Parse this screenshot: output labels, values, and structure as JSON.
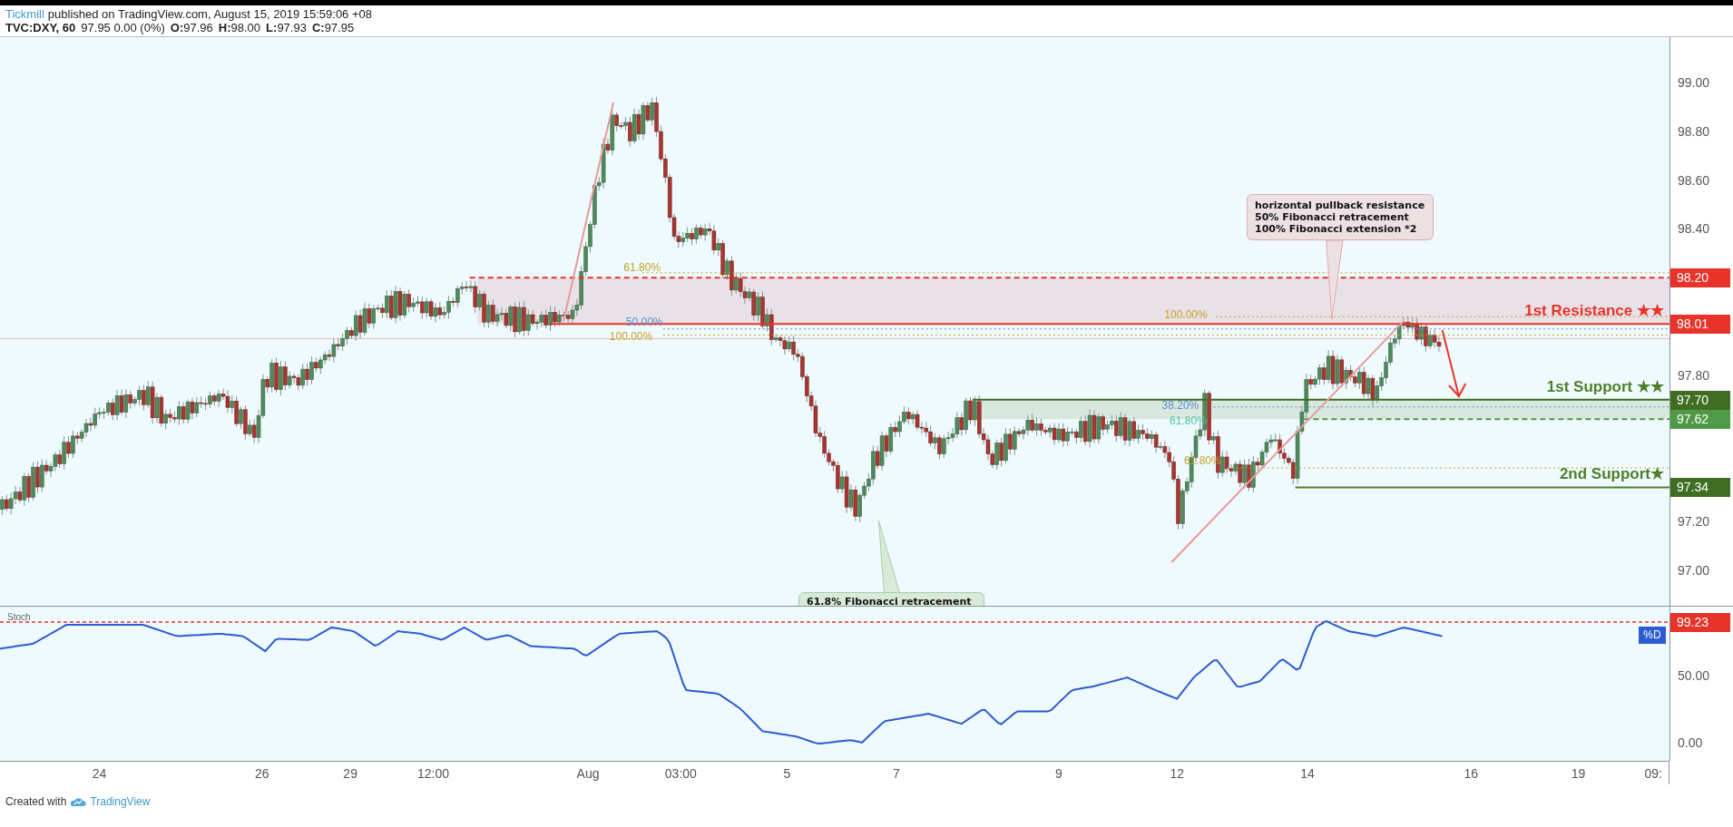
{
  "header": {
    "publisher": "Tickmill",
    "published_text": "published on TradingView.com, August 15, 2019 15:59:06 +08",
    "symbol": "TVC:DXY, 60",
    "quote": "97.95 0.00 (0%)",
    "ohlc": [
      {
        "label": "O:",
        "value": "97.96"
      },
      {
        "label": "H:",
        "value": "98.00"
      },
      {
        "label": "L:",
        "value": "97.93"
      },
      {
        "label": "C:",
        "value": "97.95"
      }
    ]
  },
  "price_axis": {
    "ticks": [
      "99.00",
      "98.80",
      "98.60",
      "98.40",
      "97.80",
      "97.20",
      "97.00"
    ]
  },
  "levels": [
    {
      "kind": "resistance",
      "price": "98.20"
    },
    {
      "kind": "resistance",
      "price": "98.01",
      "label": "1st Resistance ★★"
    },
    {
      "kind": "support",
      "price": "97.70",
      "label": "1st Support ★★"
    },
    {
      "kind": "support_zone",
      "price": "97.62"
    },
    {
      "kind": "support",
      "price": "97.34",
      "label": "2nd Support★"
    }
  ],
  "fib_labels": [
    {
      "text": "61.80%",
      "color": "#c9a227"
    },
    {
      "text": "50.00%",
      "color": "#5b8fd1"
    },
    {
      "text": "100.00%",
      "color": "#c9a227"
    },
    {
      "text": "100.00%",
      "color": "#c9a227"
    },
    {
      "text": "38.20%",
      "color": "#5b8fd1"
    },
    {
      "text": "61.80%",
      "color": "#4fc3a1"
    },
    {
      "text": "61.80%",
      "color": "#c9a227"
    }
  ],
  "callouts": [
    {
      "kind": "resistance",
      "lines": [
        "horizontal pullback resistance",
        "50% Fibonacci retracement",
        "100% Fibonacci extension *2"
      ]
    },
    {
      "kind": "support",
      "lines": [
        "61.8% Fibonacci retracement"
      ]
    }
  ],
  "stoch": {
    "title": "Stoch",
    "series_badge": "%D",
    "level_badge": "99.23",
    "ticks": [
      "50.00",
      "0.00"
    ]
  },
  "time_axis": [
    "24",
    "26",
    "29",
    "12:00",
    "Aug",
    "03:00",
    "5",
    "7",
    "9",
    "12",
    "14",
    "16",
    "19",
    "09:"
  ],
  "footer": {
    "text": "Created with",
    "brand": "TradingView"
  }
}
